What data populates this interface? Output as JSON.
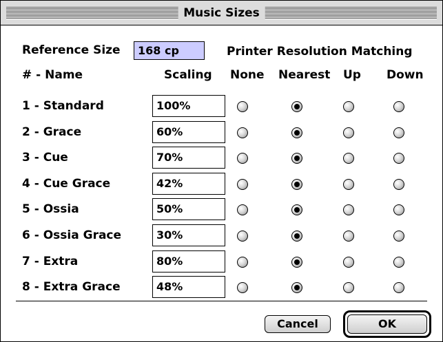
{
  "window": {
    "title": "Music Sizes"
  },
  "reference": {
    "label": "Reference Size",
    "value": "168 cp"
  },
  "headers": {
    "group": "Printer Resolution Matching",
    "name": "# - Name",
    "scaling": "Scaling",
    "none": "None",
    "nearest": "Nearest",
    "up": "Up",
    "down": "Down"
  },
  "rows": [
    {
      "name": "1 - Standard",
      "scaling": "100%",
      "selected": "Nearest"
    },
    {
      "name": "2 - Grace",
      "scaling": "60%",
      "selected": "Nearest"
    },
    {
      "name": "3 - Cue",
      "scaling": "70%",
      "selected": "Nearest"
    },
    {
      "name": "4 - Cue Grace",
      "scaling": "42%",
      "selected": "Nearest"
    },
    {
      "name": "5 - Ossia",
      "scaling": "50%",
      "selected": "Nearest"
    },
    {
      "name": "6 - Ossia Grace",
      "scaling": "30%",
      "selected": "Nearest"
    },
    {
      "name": "7 - Extra",
      "scaling": "80%",
      "selected": "Nearest"
    },
    {
      "name": "8 - Extra Grace",
      "scaling": "48%",
      "selected": "Nearest"
    }
  ],
  "buttons": {
    "cancel": "Cancel",
    "ok": "OK"
  },
  "colors": {
    "reference_field_bg": "#ccccff",
    "titlebar_bg": "#dcdcdc"
  }
}
